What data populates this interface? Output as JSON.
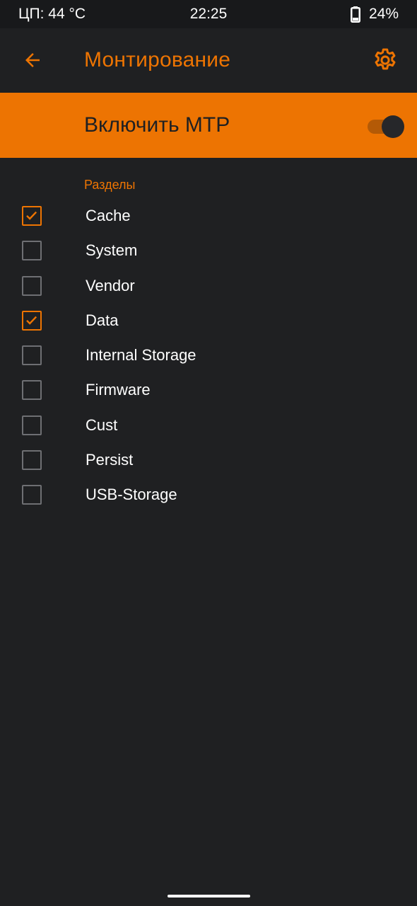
{
  "status_bar": {
    "cpu_temp": "ЦП: 44 °C",
    "time": "22:25",
    "battery": "24%"
  },
  "app_bar": {
    "title": "Монтирование",
    "back_icon": "arrow-left-icon",
    "settings_icon": "gear-icon"
  },
  "mtp": {
    "label": "Включить MTP",
    "enabled": true
  },
  "partitions": {
    "header": "Разделы",
    "items": [
      {
        "label": "Cache",
        "checked": true
      },
      {
        "label": "System",
        "checked": false
      },
      {
        "label": "Vendor",
        "checked": false
      },
      {
        "label": "Data",
        "checked": true
      },
      {
        "label": "Internal Storage",
        "checked": false
      },
      {
        "label": "Firmware",
        "checked": false
      },
      {
        "label": "Cust",
        "checked": false
      },
      {
        "label": "Persist",
        "checked": false
      },
      {
        "label": "USB-Storage",
        "checked": false
      }
    ]
  },
  "colors": {
    "accent": "#ed7402",
    "background": "#1f2022",
    "status_bar": "#18191b",
    "checkbox_unchecked": "#6e6f73"
  }
}
